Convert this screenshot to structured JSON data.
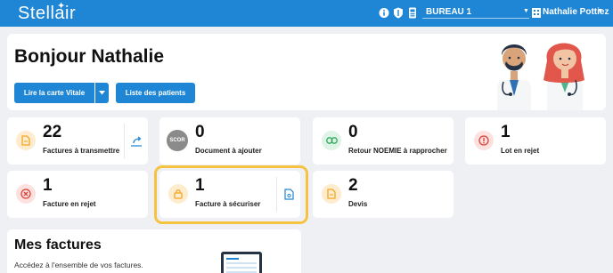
{
  "topbar": {
    "logo": "Stellair",
    "office": "BUREAU 1",
    "user": "Nathalie Pottiez"
  },
  "hero": {
    "greeting": "Bonjour Nathalie",
    "btn_vitale": "Lire la carte Vitale",
    "btn_patients": "Liste des patients"
  },
  "tiles": [
    {
      "count": "22",
      "label": "Factures à transmettre"
    },
    {
      "count": "0",
      "label": "Document à ajouter",
      "badge": "SCOR"
    },
    {
      "count": "0",
      "label": "Retour NOEMIE à rapprocher"
    },
    {
      "count": "1",
      "label": "Lot en rejet"
    },
    {
      "count": "1",
      "label": "Facture en rejet"
    },
    {
      "count": "1",
      "label": "Facture à sécuriser"
    },
    {
      "count": "2",
      "label": "Devis"
    }
  ],
  "factures": {
    "title": "Mes factures",
    "desc": "Accédez à l'ensemble de vos factures."
  },
  "colors": {
    "primary": "#1f86d6",
    "orange": "#f5a623",
    "green": "#2eaa5a",
    "red": "#e0403a",
    "highlight": "#f5c242"
  }
}
